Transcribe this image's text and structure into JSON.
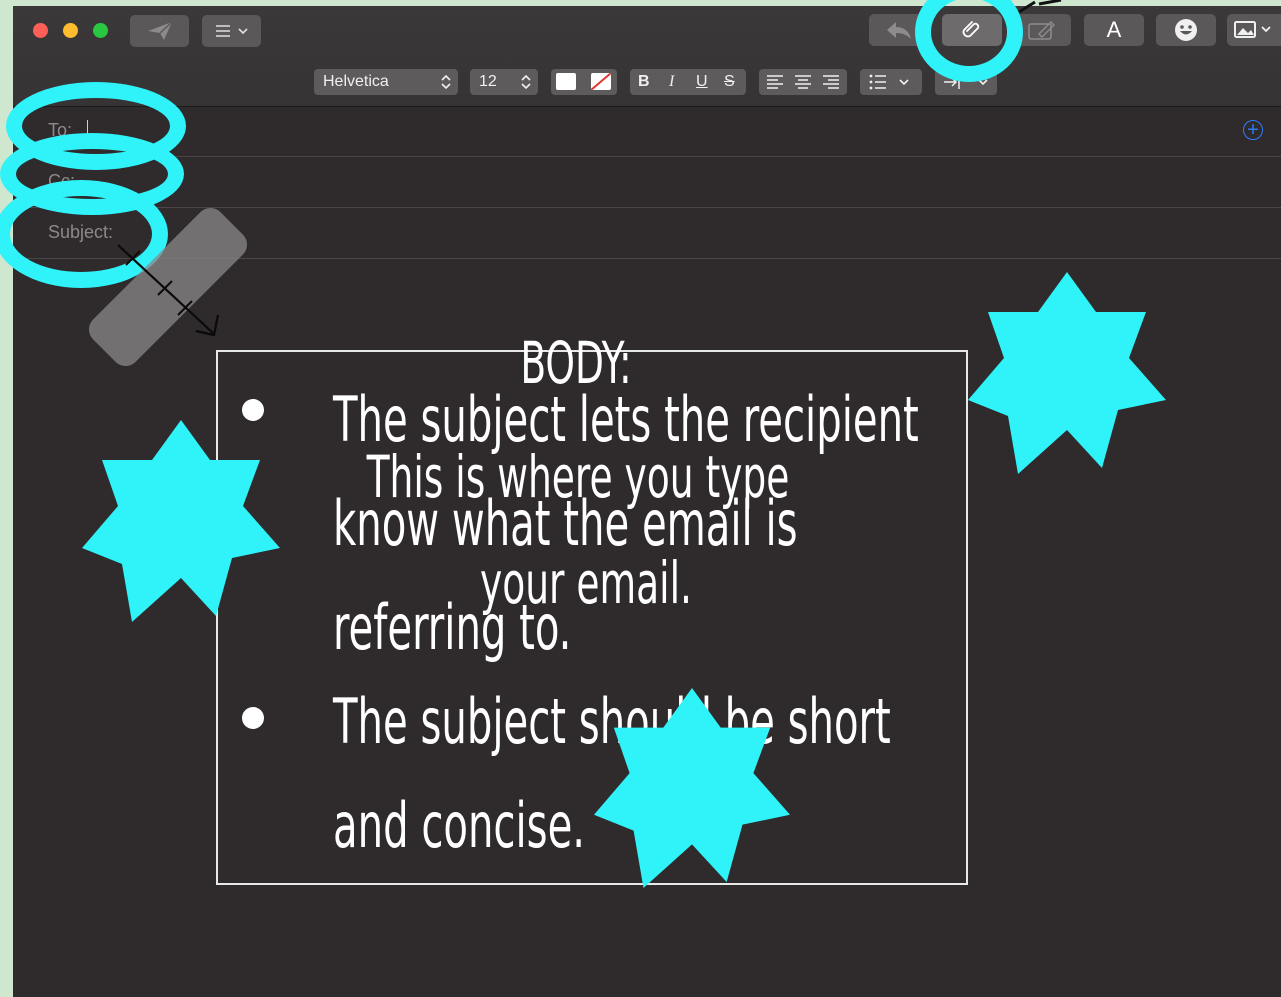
{
  "toolbar": {
    "font_name": "Helvetica",
    "font_size": "12",
    "format_buttons": {
      "bold": "B",
      "italic": "I",
      "underline": "U",
      "strike": "S"
    },
    "font_button_label": "A"
  },
  "fields": {
    "to_label": "To:",
    "cc_label": "Cc:",
    "subject_label": "Subject:",
    "add_contact": "+"
  },
  "body": {
    "heading": "BODY:",
    "heading_lines": [
      "This is where you type",
      "your email."
    ],
    "tips": [
      [
        "The subject lets the recipient",
        "know what the email is",
        "referring to."
      ],
      [
        "The subject should be short",
        "and concise."
      ]
    ]
  },
  "colors": {
    "highlight": "#2ff3f9",
    "window_bg": "#2f2a2b",
    "page_bg": "#cfe6cf",
    "accent_blue": "#2e7bf6"
  }
}
